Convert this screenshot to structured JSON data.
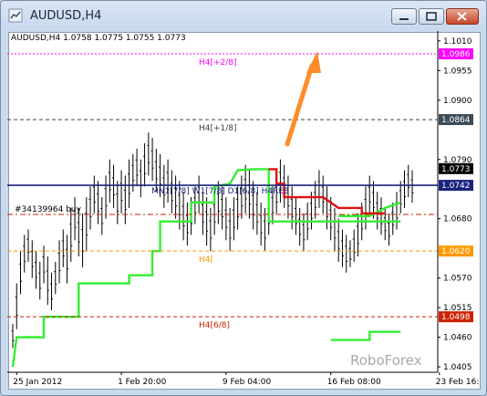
{
  "window": {
    "title": "AUDUSD,H4"
  },
  "chart_data": {
    "type": "ohlc",
    "symbol_header": "AUDUSD,H4  1.0758 1.0775 1.0755 1.0773",
    "price_axis": {
      "ticks": [
        "1.1010",
        "1.0955",
        "1.0900",
        "1.0790",
        "1.0680",
        "1.0570",
        "1.0515",
        "1.0460",
        "1.0405"
      ],
      "tick_values": [
        1.101,
        1.0955,
        1.09,
        1.079,
        1.068,
        1.057,
        1.0515,
        1.046,
        1.0405
      ],
      "ylim": [
        1.0395,
        1.1025
      ]
    },
    "time_axis": {
      "labels": [
        "25 Jan 2012",
        "1 Feb 20:00",
        "9 Feb 04:00",
        "16 Feb 08:00",
        "23 Feb 16:00"
      ],
      "label_bars": [
        1,
        28,
        55,
        82,
        110
      ]
    },
    "levels": [
      {
        "label": "H4[+2/8]",
        "price": 1.0986,
        "price_label": "1.0986",
        "color": "#ff00ff",
        "style": "dotted",
        "badge_bg": "#ff00ff",
        "badge_fg": "#ffffff"
      },
      {
        "label": "H4[+1/8]",
        "price": 1.0864,
        "price_label": "1.0864",
        "color": "#404040",
        "style": "dashed",
        "badge_bg": "#3c4b56",
        "badge_fg": "#ffffff"
      },
      {
        "label": "H4RES",
        "price": 1.0742,
        "price_label": "1.0742",
        "color": "#1a237e",
        "style": "solid",
        "badge_bg": "#1a237e",
        "badge_fg": "#ffffff"
      },
      {
        "label": "H4[",
        "price": 1.062,
        "price_label": "1.0620",
        "color": "#ff9900",
        "style": "dashed",
        "badge_bg": "#ff9900",
        "badge_fg": "#ffffff"
      },
      {
        "label": "H4[6/8]",
        "price": 1.0498,
        "price_label": "1.0498",
        "color": "#cc2200",
        "style": "dashed",
        "badge_bg": "#cc2200",
        "badge_fg": "#ffffff"
      }
    ],
    "current_price": {
      "price": 1.0773,
      "label": "1.0773"
    },
    "pivot_line": {
      "price": 1.0688,
      "color": "#cc2200",
      "label": "#34139964 buy"
    },
    "overlay_text": "MN1[7/8]  W1[7/8]  D1[6/8]  H4RES",
    "watermark": "RoboForex",
    "arrow_color": "#ff8c2a",
    "series": [
      {
        "kind": "ohlc",
        "color": "#000000",
        "bars": [
          [
            1.0485,
            1.044
          ],
          [
            1.056,
            1.0475
          ],
          [
            1.062,
            1.054
          ],
          [
            1.065,
            1.058
          ],
          [
            1.066,
            1.06
          ],
          [
            1.064,
            1.057
          ],
          [
            1.062,
            1.055
          ],
          [
            1.06,
            1.053
          ],
          [
            1.063,
            1.056
          ],
          [
            1.061,
            1.052
          ],
          [
            1.058,
            1.051
          ],
          [
            1.06,
            1.054
          ],
          [
            1.064,
            1.056
          ],
          [
            1.066,
            1.059
          ],
          [
            1.065,
            1.056
          ],
          [
            1.07,
            1.06
          ],
          [
            1.072,
            1.064
          ],
          [
            1.07,
            1.061
          ],
          [
            1.069,
            1.059
          ],
          [
            1.072,
            1.062
          ],
          [
            1.074,
            1.066
          ],
          [
            1.076,
            1.069
          ],
          [
            1.075,
            1.067
          ],
          [
            1.072,
            1.065
          ],
          [
            1.076,
            1.068
          ],
          [
            1.079,
            1.071
          ],
          [
            1.078,
            1.07
          ],
          [
            1.075,
            1.067
          ],
          [
            1.077,
            1.069
          ],
          [
            1.076,
            1.067
          ],
          [
            1.079,
            1.07
          ],
          [
            1.08,
            1.073
          ],
          [
            1.081,
            1.074
          ],
          [
            1.079,
            1.072
          ],
          [
            1.082,
            1.074
          ],
          [
            1.084,
            1.076
          ],
          [
            1.083,
            1.075
          ],
          [
            1.081,
            1.073
          ],
          [
            1.08,
            1.072
          ],
          [
            1.078,
            1.07
          ],
          [
            1.079,
            1.071
          ],
          [
            1.077,
            1.069
          ],
          [
            1.076,
            1.068
          ],
          [
            1.075,
            1.066
          ],
          [
            1.073,
            1.064
          ],
          [
            1.071,
            1.063
          ],
          [
            1.072,
            1.065
          ],
          [
            1.074,
            1.067
          ],
          [
            1.076,
            1.069
          ],
          [
            1.073,
            1.065
          ],
          [
            1.072,
            1.063
          ],
          [
            1.07,
            1.062
          ],
          [
            1.073,
            1.065
          ],
          [
            1.075,
            1.067
          ],
          [
            1.074,
            1.066
          ],
          [
            1.072,
            1.064
          ],
          [
            1.07,
            1.062
          ],
          [
            1.072,
            1.064
          ],
          [
            1.074,
            1.066
          ],
          [
            1.076,
            1.068
          ],
          [
            1.078,
            1.069
          ],
          [
            1.077,
            1.068
          ],
          [
            1.075,
            1.066
          ],
          [
            1.073,
            1.065
          ],
          [
            1.071,
            1.063
          ],
          [
            1.07,
            1.062
          ],
          [
            1.072,
            1.065
          ],
          [
            1.074,
            1.067
          ],
          [
            1.076,
            1.069
          ],
          [
            1.079,
            1.071
          ],
          [
            1.078,
            1.07
          ],
          [
            1.076,
            1.068
          ],
          [
            1.074,
            1.066
          ],
          [
            1.072,
            1.065
          ],
          [
            1.07,
            1.063
          ],
          [
            1.069,
            1.062
          ],
          [
            1.071,
            1.064
          ],
          [
            1.073,
            1.066
          ],
          [
            1.075,
            1.068
          ],
          [
            1.077,
            1.07
          ],
          [
            1.076,
            1.069
          ],
          [
            1.074,
            1.066
          ],
          [
            1.072,
            1.064
          ],
          [
            1.07,
            1.062
          ],
          [
            1.068,
            1.06
          ],
          [
            1.066,
            1.059
          ],
          [
            1.065,
            1.058
          ],
          [
            1.064,
            1.059
          ],
          [
            1.066,
            1.06
          ],
          [
            1.069,
            1.061
          ],
          [
            1.071,
            1.064
          ],
          [
            1.074,
            1.066
          ],
          [
            1.076,
            1.069
          ],
          [
            1.075,
            1.068
          ],
          [
            1.073,
            1.066
          ],
          [
            1.072,
            1.065
          ],
          [
            1.07,
            1.064
          ],
          [
            1.069,
            1.063
          ],
          [
            1.071,
            1.065
          ],
          [
            1.073,
            1.066
          ],
          [
            1.075,
            1.069
          ],
          [
            1.077,
            1.07
          ],
          [
            1.078,
            1.072
          ],
          [
            1.077,
            1.071
          ]
        ]
      },
      {
        "kind": "stepline",
        "color": "#33ee33",
        "points": [
          [
            0,
            1.0405
          ],
          [
            1,
            1.046
          ],
          [
            8,
            1.046
          ],
          [
            8,
            1.0498
          ],
          [
            17,
            1.0498
          ],
          [
            17,
            1.056
          ],
          [
            30,
            1.056
          ],
          [
            30,
            1.0575
          ],
          [
            36,
            1.0575
          ],
          [
            36,
            1.062
          ],
          [
            38,
            1.062
          ],
          [
            38,
            1.0675
          ],
          [
            46,
            1.0675
          ],
          [
            46,
            1.071
          ],
          [
            52,
            1.071
          ],
          [
            52,
            1.074
          ],
          [
            56,
            1.0745
          ],
          [
            58,
            1.077
          ],
          [
            62,
            1.0772
          ],
          [
            66,
            1.0772
          ],
          [
            66,
            1.0675
          ],
          [
            100,
            1.0675
          ]
        ]
      },
      {
        "kind": "stepline",
        "color": "#33ee33",
        "points": [
          [
            82,
            1.0455
          ],
          [
            92,
            1.0455
          ],
          [
            92,
            1.047
          ],
          [
            100,
            1.047
          ]
        ]
      },
      {
        "kind": "stepline",
        "color": "#33ee33",
        "points": [
          [
            84,
            1.0685
          ],
          [
            92,
            1.0685
          ],
          [
            96,
            1.07
          ],
          [
            100,
            1.071
          ]
        ]
      },
      {
        "kind": "stepline",
        "color": "#dd1111",
        "points": [
          [
            66,
            1.0772
          ],
          [
            68,
            1.0772
          ],
          [
            68,
            1.0745
          ],
          [
            70,
            1.0745
          ],
          [
            70,
            1.072
          ],
          [
            80,
            1.072
          ],
          [
            84,
            1.07
          ],
          [
            90,
            1.07
          ],
          [
            90,
            1.069
          ],
          [
            96,
            1.069
          ]
        ]
      }
    ]
  }
}
